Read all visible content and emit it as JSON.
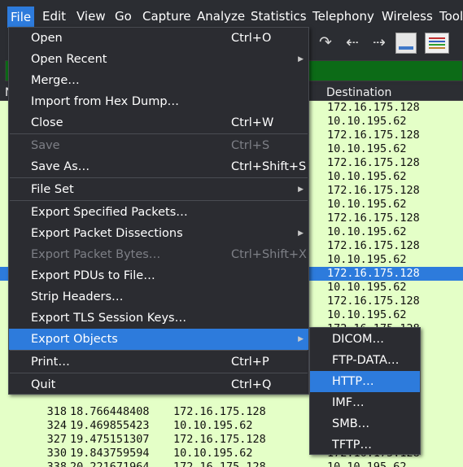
{
  "menubar": {
    "items": [
      {
        "label": "File"
      },
      {
        "label": "Edit"
      },
      {
        "label": "View"
      },
      {
        "label": "Go"
      },
      {
        "label": "Capture"
      },
      {
        "label": "Analyze"
      },
      {
        "label": "Statistics"
      },
      {
        "label": "Telephony"
      },
      {
        "label": "Wireless"
      },
      {
        "label": "Tool"
      }
    ],
    "active": "File"
  },
  "packet_list": {
    "columns": {
      "no": "N",
      "destination": "Destination"
    },
    "rows": [
      {
        "destination": "172.16.175.128"
      },
      {
        "destination": "10.10.195.62"
      },
      {
        "destination": "172.16.175.128"
      },
      {
        "destination": "10.10.195.62"
      },
      {
        "destination": "172.16.175.128"
      },
      {
        "destination": "10.10.195.62"
      },
      {
        "destination": "172.16.175.128"
      },
      {
        "destination": "10.10.195.62"
      },
      {
        "destination": "172.16.175.128"
      },
      {
        "destination": "10.10.195.62"
      },
      {
        "destination": "172.16.175.128"
      },
      {
        "destination": "10.10.195.62"
      },
      {
        "destination": "172.16.175.128",
        "selected": true
      },
      {
        "destination": "10.10.195.62"
      },
      {
        "destination": "172.16.175.128"
      },
      {
        "destination": "10.10.195.62"
      },
      {
        "destination": "172.16.175.128"
      },
      {
        "destination": "10.10.195.62"
      },
      {
        "destination": "172.16.175.128"
      },
      {
        "destination": "10.10.195.62"
      },
      {
        "destination": "172.16.175.128"
      },
      {
        "destination": "10.10.195.62"
      },
      {
        "no": "318",
        "time": "18.766448408",
        "source": "172.16.175.128",
        "destination": ""
      },
      {
        "no": "324",
        "time": "19.469855423",
        "source": "10.10.195.62",
        "destination": "172.16.175.128"
      },
      {
        "no": "327",
        "time": "19.475151307",
        "source": "172.16.175.128",
        "destination": "10.10.195.62"
      },
      {
        "no": "330",
        "time": "19.843759594",
        "source": "10.10.195.62",
        "destination": "172.16.175.128"
      },
      {
        "no": "338",
        "time": "20.221671964",
        "source": "172.16.175.128",
        "destination": "10.10.195.62"
      },
      {
        "no": "340",
        "time": "20.568806675",
        "source": "10.10.195.62",
        "destination": "172.16.175.128"
      }
    ]
  },
  "file_menu": {
    "items": [
      {
        "label": "Open",
        "shortcut": "Ctrl+O"
      },
      {
        "label": "Open Recent",
        "submenu": true
      },
      {
        "label": "Merge…"
      },
      {
        "label": "Import from Hex Dump…"
      },
      {
        "label": "Close",
        "shortcut": "Ctrl+W"
      },
      {
        "label": "Save",
        "shortcut": "Ctrl+S",
        "disabled": true
      },
      {
        "label": "Save As…",
        "shortcut": "Ctrl+Shift+S"
      },
      {
        "label": "File Set",
        "submenu": true
      },
      {
        "label": "Export Specified Packets…"
      },
      {
        "label": "Export Packet Dissections",
        "submenu": true
      },
      {
        "label": "Export Packet Bytes…",
        "shortcut": "Ctrl+Shift+X",
        "disabled": true
      },
      {
        "label": "Export PDUs to File…"
      },
      {
        "label": "Strip Headers…"
      },
      {
        "label": "Export TLS Session Keys…"
      },
      {
        "label": "Export Objects",
        "submenu": true,
        "active": true
      },
      {
        "label": "Print…",
        "shortcut": "Ctrl+P"
      },
      {
        "label": "Quit",
        "shortcut": "Ctrl+Q"
      }
    ]
  },
  "export_objects_menu": {
    "items": [
      {
        "label": "DICOM…"
      },
      {
        "label": "FTP-DATA…"
      },
      {
        "label": "HTTP…",
        "active": true
      },
      {
        "label": "IMF…"
      },
      {
        "label": "SMB…"
      },
      {
        "label": "TFTP…"
      }
    ]
  },
  "toolbar": {
    "icons": [
      "jump-icon",
      "go-back-icon",
      "go-forward-icon",
      "autoscroll-icon",
      "colorize-icon"
    ]
  },
  "colors": {
    "menu_bg": "#2b2c31",
    "accent": "#2d7bdc",
    "packet_row_bg": "#e4ffc7",
    "filter_bg": "#0c6b17"
  }
}
